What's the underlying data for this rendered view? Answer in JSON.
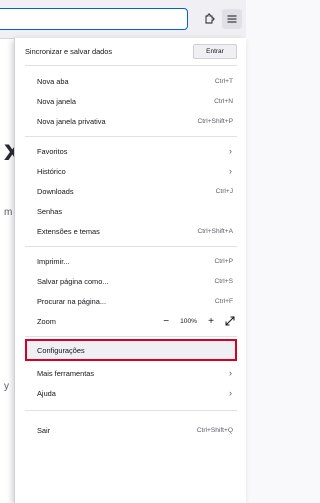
{
  "menu": {
    "sync": {
      "label": "Sincronizar e salvar dados",
      "button": "Entrar"
    },
    "new_tab": {
      "label": "Nova aba",
      "shortcut": "Ctrl+T"
    },
    "new_window": {
      "label": "Nova janela",
      "shortcut": "Ctrl+N"
    },
    "private": {
      "label": "Nova janela privativa",
      "shortcut": "Ctrl+Shift+P"
    },
    "bookmarks": {
      "label": "Favoritos"
    },
    "history": {
      "label": "Histórico"
    },
    "downloads": {
      "label": "Downloads",
      "shortcut": "Ctrl+J"
    },
    "passwords": {
      "label": "Senhas"
    },
    "addons": {
      "label": "Extensões e temas",
      "shortcut": "Ctrl+Shift+A"
    },
    "print": {
      "label": "Imprimir...",
      "shortcut": "Ctrl+P"
    },
    "save_page": {
      "label": "Salvar página como...",
      "shortcut": "Ctrl+S"
    },
    "find": {
      "label": "Procurar na página...",
      "shortcut": "Ctrl+F"
    },
    "zoom": {
      "label": "Zoom",
      "value": "100%",
      "minus": "−",
      "plus": "+"
    },
    "settings": {
      "label": "Configurações"
    },
    "more_tools": {
      "label": "Mais ferramentas"
    },
    "help": {
      "label": "Ajuda"
    },
    "exit": {
      "label": "Sair",
      "shortcut": "Ctrl+Shift+Q"
    },
    "chevron": "›"
  },
  "background": {
    "partial_x": "x",
    "partial_m": "m",
    "partial_y": "y"
  },
  "colors": {
    "highlight_border": "#d70022",
    "url_focus": "#0061e0"
  }
}
